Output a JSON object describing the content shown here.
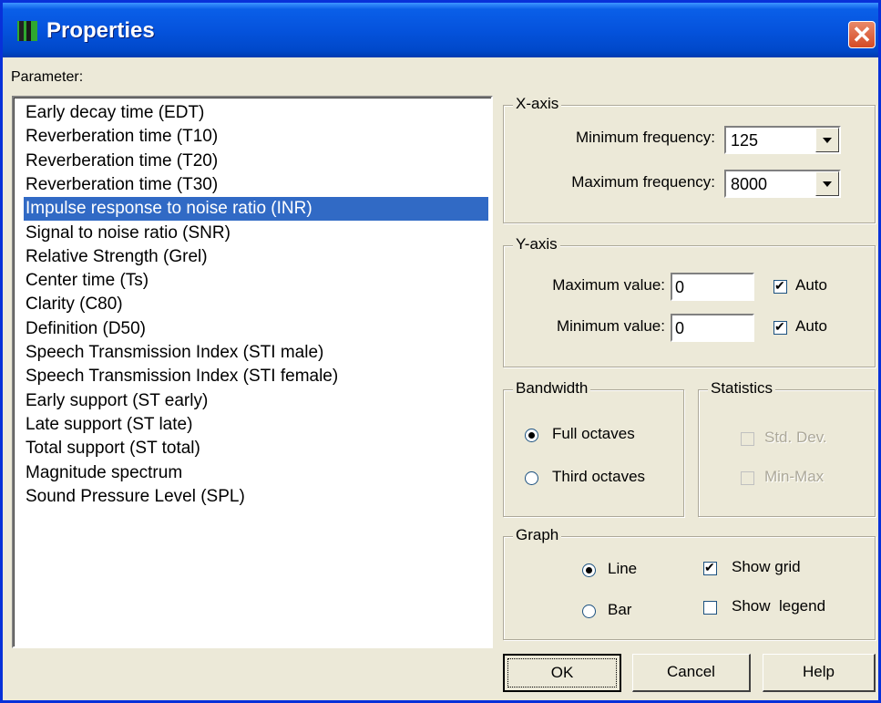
{
  "window": {
    "title": "Properties"
  },
  "parameter_label": "Parameter:",
  "parameters": [
    "Early decay time (EDT)",
    "Reverberation time (T10)",
    "Reverberation time (T20)",
    "Reverberation time (T30)",
    "Impulse response to noise ratio (INR)",
    "Signal to noise ratio (SNR)",
    "Relative Strength (Grel)",
    "Center time (Ts)",
    "Clarity (C80)",
    "Definition (D50)",
    "Speech Transmission Index (STI male)",
    "Speech Transmission Index (STI female)",
    "Early support (ST early)",
    "Late support (ST late)",
    "Total support (ST total)",
    "Magnitude spectrum",
    "Sound Pressure Level (SPL)"
  ],
  "selected_parameter": "Impulse response to noise ratio (INR)",
  "xaxis": {
    "legend": "X-axis",
    "min_label": "Minimum frequency:",
    "min_value": "125",
    "max_label": "Maximum frequency:",
    "max_value": "8000"
  },
  "yaxis": {
    "legend": "Y-axis",
    "max_label": "Maximum value:",
    "max_value": "0",
    "max_auto_label": "Auto",
    "max_auto_checked": true,
    "min_label": "Minimum value:",
    "min_value": "0",
    "min_auto_label": "Auto",
    "min_auto_checked": true
  },
  "bandwidth": {
    "legend": "Bandwidth",
    "full_label": "Full octaves",
    "third_label": "Third octaves",
    "selected": "Full octaves"
  },
  "statistics": {
    "legend": "Statistics",
    "stddev_label": "Std. Dev.",
    "minmax_label": "Min-Max"
  },
  "graph": {
    "legend": "Graph",
    "line_label": "Line",
    "bar_label": "Bar",
    "selected": "Line",
    "grid_label": "Show grid",
    "grid_checked": true,
    "legend_label": "Show  legend",
    "legend_checked": false
  },
  "buttons": {
    "ok": "OK",
    "cancel": "Cancel",
    "help": "Help"
  }
}
